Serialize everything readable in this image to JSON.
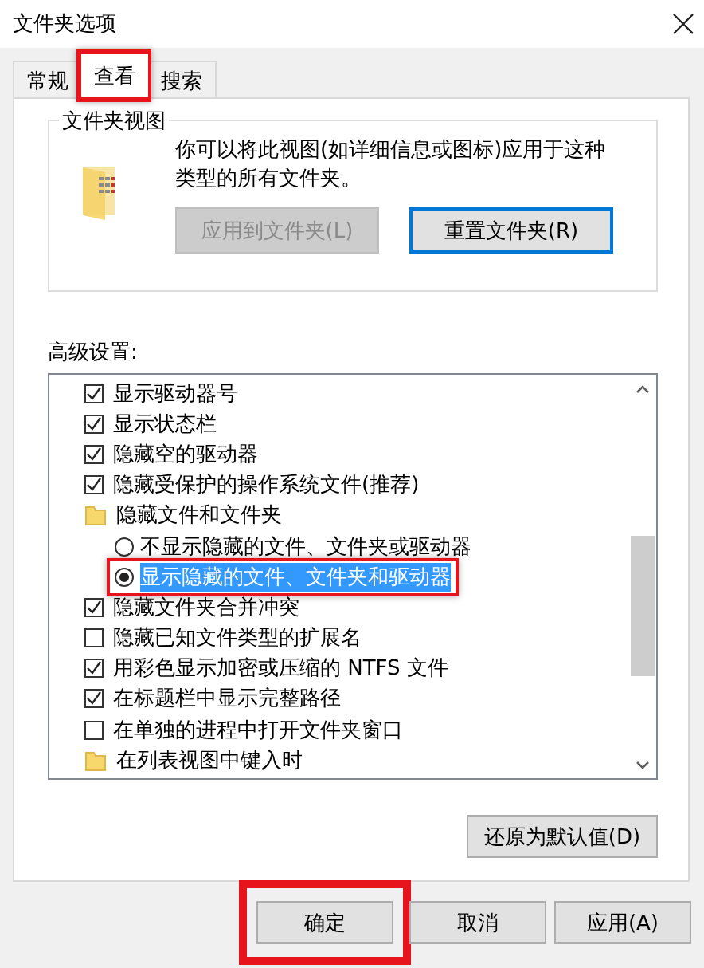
{
  "window": {
    "title": "文件夹选项"
  },
  "tabs": [
    {
      "label": "常规",
      "selected": false,
      "highlighted": false
    },
    {
      "label": "查看",
      "selected": true,
      "highlighted": true
    },
    {
      "label": "搜索",
      "selected": false,
      "highlighted": false
    }
  ],
  "folder_views": {
    "title": "文件夹视图",
    "description": "你可以将此视图(如详细信息或图标)应用于这种类型的所有文件夹。",
    "buttons": [
      {
        "label": "应用到文件夹(L)",
        "disabled": true,
        "focused": false
      },
      {
        "label": "重置文件夹(R)",
        "disabled": false,
        "focused": true
      }
    ]
  },
  "advanced": {
    "label": "高级设置:",
    "items": [
      {
        "kind": "checkbox",
        "label": "显示驱动器号",
        "checked": true
      },
      {
        "kind": "checkbox",
        "label": "显示状态栏",
        "checked": true
      },
      {
        "kind": "checkbox",
        "label": "隐藏空的驱动器",
        "checked": true
      },
      {
        "kind": "checkbox",
        "label": "隐藏受保护的操作系统文件(推荐)",
        "checked": true
      },
      {
        "kind": "folder",
        "label": "隐藏文件和文件夹"
      },
      {
        "kind": "radio",
        "label": "不显示隐藏的文件、文件夹或驱动器",
        "selected": false,
        "highlighted": false
      },
      {
        "kind": "radio",
        "label": "显示隐藏的文件、文件夹和驱动器",
        "selected": true,
        "highlighted": true
      },
      {
        "kind": "checkbox",
        "label": "隐藏文件夹合并冲突",
        "checked": true
      },
      {
        "kind": "checkbox",
        "label": "隐藏已知文件类型的扩展名",
        "checked": false
      },
      {
        "kind": "checkbox",
        "label": "用彩色显示加密或压缩的 NTFS 文件",
        "checked": true
      },
      {
        "kind": "checkbox",
        "label": "在标题栏中显示完整路径",
        "checked": true
      },
      {
        "kind": "checkbox",
        "label": "在单独的进程中打开文件夹窗口",
        "checked": false
      },
      {
        "kind": "folder",
        "label": "在列表视图中键入时"
      }
    ],
    "restore_button": "还原为默认值(D)"
  },
  "buttons": [
    {
      "label": "确定",
      "highlighted": true
    },
    {
      "label": "取消",
      "highlighted": false
    },
    {
      "label": "应用(A)",
      "highlighted": false
    }
  ]
}
